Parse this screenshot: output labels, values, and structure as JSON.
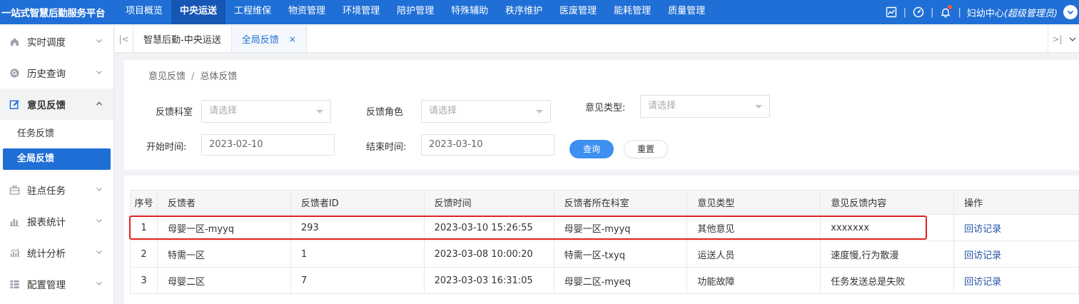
{
  "app": {
    "brand": "一站式智慧后勤服务平台",
    "nav": [
      "项目概览",
      "中央运送",
      "工程维保",
      "物资管理",
      "环境管理",
      "陪护管理",
      "特殊辅助",
      "秩序维护",
      "医废管理",
      "能耗管理",
      "质量管理"
    ],
    "active_nav": "中央运送",
    "user_prefix": "妇幼中心",
    "user_role": "(超级管理员)",
    "sep": "|"
  },
  "sidebar": {
    "items": [
      {
        "label": "实时调度",
        "icon": "home-icon"
      },
      {
        "label": "历史查询",
        "icon": "search-icon"
      },
      {
        "label": "意见反馈",
        "icon": "edit-icon"
      },
      {
        "label": "驻点任务",
        "icon": "briefcase-icon"
      },
      {
        "label": "报表统计",
        "icon": "bar-chart-icon"
      },
      {
        "label": "统计分析",
        "icon": "analysis-icon"
      },
      {
        "label": "配置管理",
        "icon": "grid-icon"
      }
    ],
    "sub_items": [
      "任务反馈",
      "全局反馈"
    ]
  },
  "tabs": [
    {
      "label": "智慧后勤-中央运送"
    },
    {
      "label": "全局反馈",
      "close": "×"
    }
  ],
  "breadcrumb": [
    "意见反馈",
    "总体反馈"
  ],
  "breadcrumb_sep": "/",
  "filters": {
    "dept_label": "反馈科室",
    "dept_placeholder": "请选择",
    "role_label": "反馈角色",
    "role_placeholder": "请选择",
    "type_label": "意见类型:",
    "type_placeholder": "请选择",
    "start_label": "开始时间:",
    "start_value": "2023-02-10",
    "end_label": "结束时间:",
    "end_value": "2023-03-10",
    "query_btn": "查询",
    "reset_btn": "重置"
  },
  "table": {
    "headers": [
      "序号",
      "反馈者",
      "反馈者ID",
      "反馈时间",
      "反馈者所在科室",
      "意见类型",
      "意见反馈内容",
      "操作"
    ],
    "rows": [
      [
        "1",
        "母婴一区-myyq",
        "293",
        "2023-03-10 15:26:55",
        "母婴一区-myyq",
        "其他意见",
        "xxxxxxx",
        "回访记录"
      ],
      [
        "2",
        "特需一区",
        "1",
        "2023-03-08 10:00:20",
        "特需一区-txyq",
        "运送人员",
        "速度慢,行为散漫",
        "回访记录"
      ],
      [
        "3",
        "母婴二区",
        "7",
        "2023-03-03 16:31:05",
        "母婴二区-myeq",
        "功能故障",
        "任务发送总是失败",
        "回访记录"
      ]
    ]
  },
  "colors": {
    "primary": "#1f6fd6",
    "highlight": "#e02020"
  }
}
